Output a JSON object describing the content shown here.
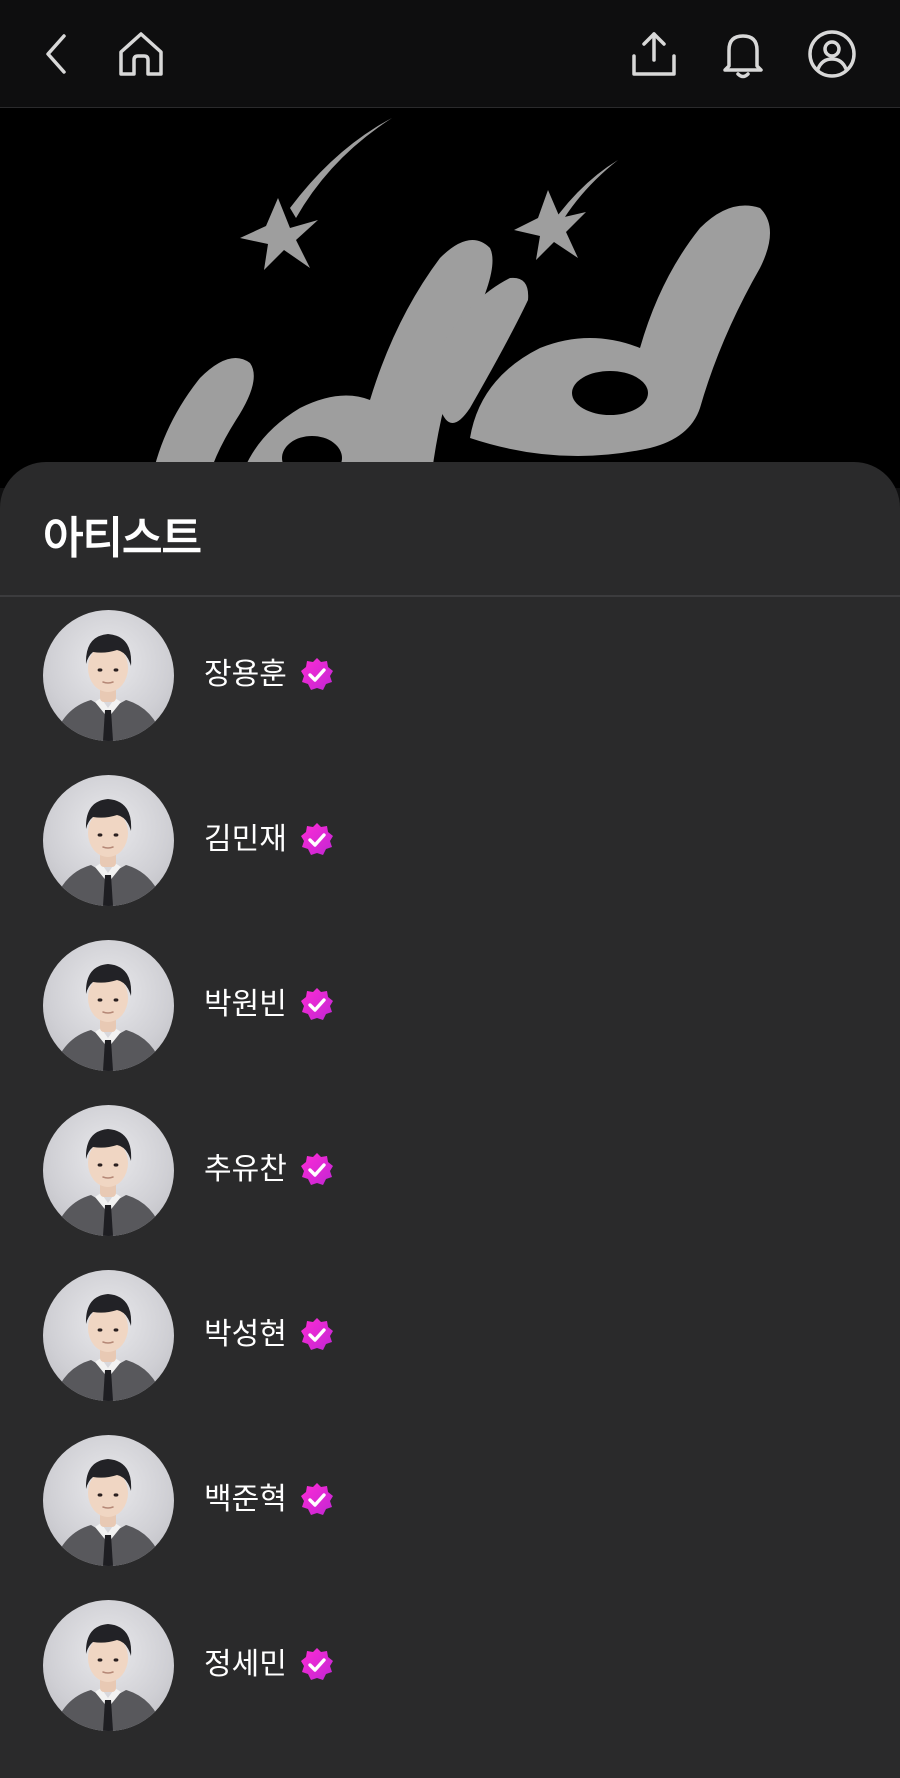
{
  "header": {
    "back_icon": "chevron-left-icon",
    "home_icon": "home-icon",
    "share_icon": "share-upload-icon",
    "bell_icon": "bell-icon",
    "profile_icon": "user-circle-icon"
  },
  "banner": {
    "logo_text": "idid",
    "background": "#000000",
    "logo_color": "#9e9e9e"
  },
  "sheet": {
    "title": "아티스트",
    "background": "#2a2a2b"
  },
  "artists": [
    {
      "name": "장용훈",
      "verified": true
    },
    {
      "name": "김민재",
      "verified": true
    },
    {
      "name": "박원빈",
      "verified": true
    },
    {
      "name": "추유찬",
      "verified": true
    },
    {
      "name": "박성현",
      "verified": true
    },
    {
      "name": "백준혁",
      "verified": true
    },
    {
      "name": "정세민",
      "verified": true
    }
  ],
  "colors": {
    "accent_badge_start": "#c026d3",
    "accent_badge_end": "#ff2bd6",
    "text_primary": "#ffffff"
  }
}
